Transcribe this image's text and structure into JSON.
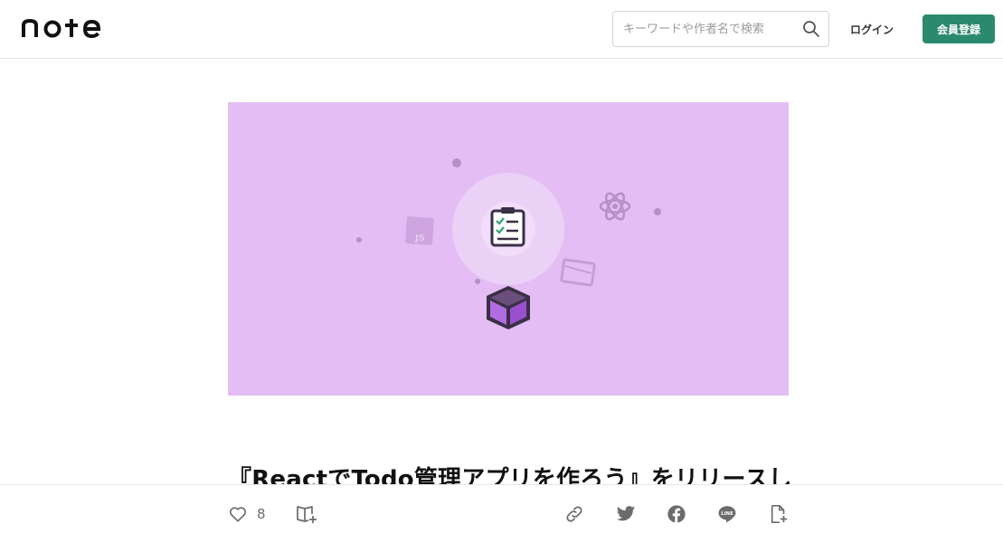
{
  "header": {
    "logo_text": "note",
    "search": {
      "placeholder": "キーワードや作者名で検索",
      "value": ""
    },
    "login_label": "ログイン",
    "signup_label": "会員登録",
    "colors": {
      "signup_bg": "#2b8a6e"
    }
  },
  "hero": {
    "background": "#e3bdf3",
    "icons": [
      "clipboard-checklist-icon",
      "cube-icon",
      "react-atom-icon",
      "js-file-icon",
      "folder-icon"
    ],
    "badge_text": "JS"
  },
  "article": {
    "title": "『ReactでTodo管理アプリを作ろう』をリリースし"
  },
  "actions": {
    "like_count": "8",
    "icons": [
      "heart-icon",
      "magazine-add-icon",
      "link-icon",
      "twitter-icon",
      "facebook-icon",
      "line-icon",
      "embed-icon"
    ]
  }
}
